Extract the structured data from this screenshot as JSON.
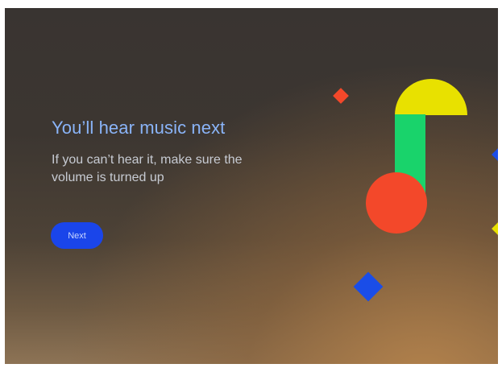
{
  "onboarding": {
    "title": "You’ll hear music next",
    "subtitle": "If you can’t hear it, make sure the volume is turned up",
    "next_label": "Next"
  },
  "colors": {
    "title": "#8ab4f8",
    "button": "#1a45ea",
    "yellow_shape": "#e8e100",
    "green_shape": "#19d36b",
    "red_shape": "#f3482a",
    "blue_shape": "#1a4de8"
  },
  "decorations": [
    "music-note-icon",
    "diamond-icons"
  ]
}
